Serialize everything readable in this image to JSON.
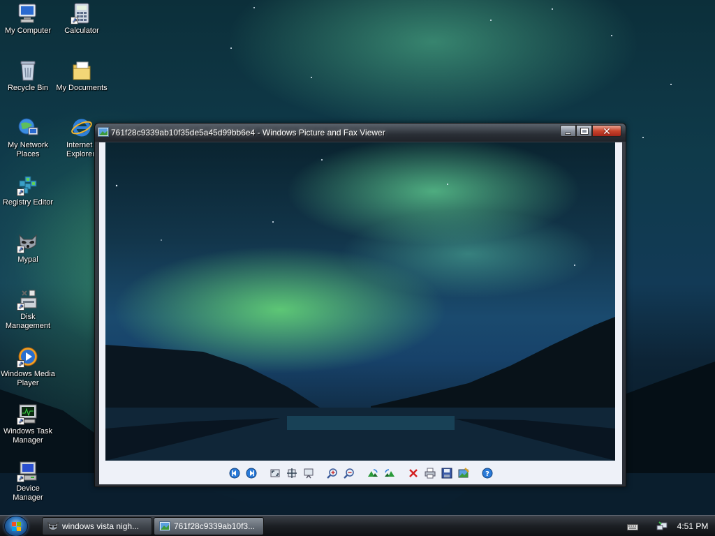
{
  "desktop": {
    "icons": [
      {
        "label": "My Computer"
      },
      {
        "label": "Calculator"
      },
      {
        "label": "Recycle Bin"
      },
      {
        "label": "My Documents"
      },
      {
        "label": "My Network Places"
      },
      {
        "label": "Internet Explorer"
      },
      {
        "label": "Registry Editor"
      },
      {
        "label": "Mypal"
      },
      {
        "label": "Disk Management"
      },
      {
        "label": "Windows Media Player"
      },
      {
        "label": "Windows Task Manager"
      },
      {
        "label": "Device Manager"
      }
    ]
  },
  "viewer": {
    "title": "761f28c9339ab10f35de5a45d99bb6e4 - Windows Picture and Fax Viewer",
    "toolbar": [
      {
        "icon": "previous-image-icon"
      },
      {
        "icon": "next-image-icon"
      },
      {
        "icon": "best-fit-icon"
      },
      {
        "icon": "actual-size-icon"
      },
      {
        "icon": "slideshow-icon"
      },
      {
        "icon": "zoom-in-icon"
      },
      {
        "icon": "zoom-out-icon"
      },
      {
        "icon": "rotate-clockwise-icon"
      },
      {
        "icon": "rotate-counterclockwise-icon"
      },
      {
        "icon": "delete-icon"
      },
      {
        "icon": "print-icon"
      },
      {
        "icon": "save-icon"
      },
      {
        "icon": "edit-icon"
      },
      {
        "icon": "help-icon"
      }
    ]
  },
  "taskbar": {
    "tasks": [
      {
        "label": "windows vista nigh..."
      },
      {
        "label": "761f28c9339ab10f3..."
      }
    ],
    "clock": "4:51 PM"
  },
  "colors": {
    "accent": "#2a6fb5",
    "close": "#c8452c"
  }
}
